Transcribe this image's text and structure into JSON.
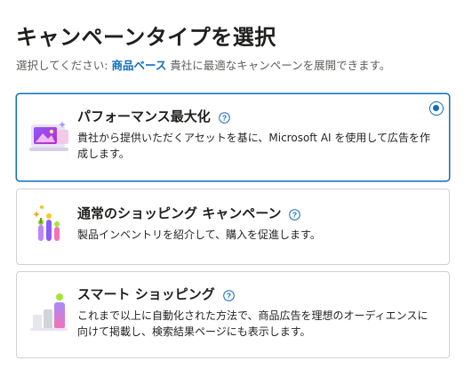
{
  "header": {
    "title": "キャンペーンタイプを選択",
    "subtitle_prefix": "選択してください: ",
    "subtitle_link": "商品ベース",
    "subtitle_suffix": " 貴社に最適なキャンペーンを展開できます。"
  },
  "options": [
    {
      "title": "パフォーマンス最大化",
      "description": "貴社から提供いただくアセットを基に、Microsoft AI を使用して広告を作成します。",
      "selected": true,
      "icon": "performance-max-illustration-icon"
    },
    {
      "title": "通常のショッピング キャンペーン",
      "description": "製品インベントリを紹介して、購入を促進します。",
      "selected": false,
      "icon": "standard-shopping-illustration-icon"
    },
    {
      "title": "スマート ショッピング",
      "description": "これまで以上に自動化された方法で、商品広告を理想のオーディエンスに向けて掲載し、検索結果ページにも表示します。",
      "selected": false,
      "icon": "smart-shopping-illustration-icon"
    }
  ],
  "colors": {
    "accent": "#0f6cbd",
    "border": "#d1d1d1",
    "text": "#242424",
    "muted": "#605e5c"
  }
}
